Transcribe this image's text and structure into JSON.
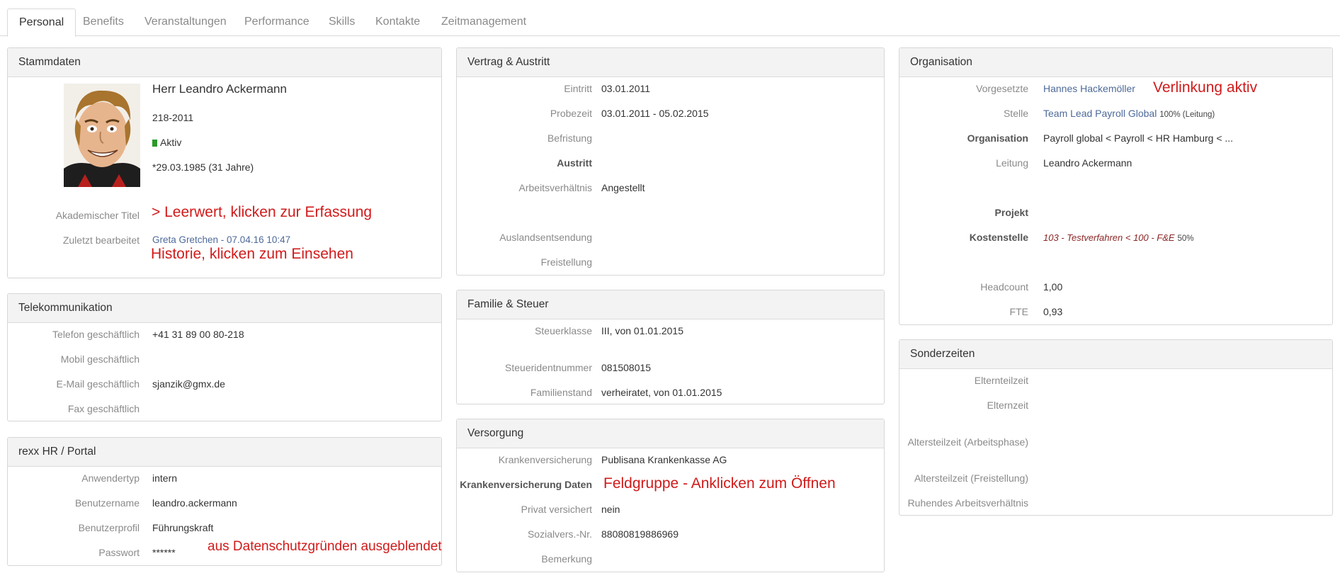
{
  "tabs": [
    "Personal",
    "Benefits",
    "Veranstaltungen",
    "Performance",
    "Skills",
    "Kontakte",
    "Zeitmanagement"
  ],
  "colors": {
    "link": "#4e6a9a",
    "annotation": "#d11a1a",
    "status_active": "#2a9a2a",
    "cost_center": "#8b2626"
  },
  "stammdaten": {
    "title": "Stammdaten",
    "name": "Herr Leandro Ackermann",
    "personnel_number": "218-2011",
    "status": "Aktiv",
    "birth": "*29.03.1985 (31 Jahre)",
    "akademischer_titel_label": "Akademischer Titel",
    "zuletzt_bearbeitet_label": "Zuletzt bearbeitet",
    "zuletzt_bearbeitet_value": "Greta Gretchen - 07.04.16 10:47"
  },
  "telekommunikation": {
    "title": "Telekommunikation",
    "rows": [
      {
        "label": "Telefon geschäftlich",
        "value": "+41 31 89 00 80-218"
      },
      {
        "label": "Mobil geschäftlich",
        "value": ""
      },
      {
        "label": "E-Mail geschäftlich",
        "value": "sjanzik@gmx.de"
      },
      {
        "label": "Fax geschäftlich",
        "value": ""
      }
    ]
  },
  "portal": {
    "title": "rexx HR / Portal",
    "rows": [
      {
        "label": "Anwendertyp",
        "value": "intern"
      },
      {
        "label": "Benutzername",
        "value": "leandro.ackermann"
      },
      {
        "label": "Benutzerprofil",
        "value": "Führungskraft"
      },
      {
        "label": "Passwort",
        "value": "******"
      }
    ]
  },
  "vertrag": {
    "title": "Vertrag & Austritt",
    "rows": [
      {
        "label": "Eintritt",
        "value": "03.01.2011"
      },
      {
        "label": "Probezeit",
        "value": "03.01.2011 - 05.02.2015"
      },
      {
        "label": "Befristung",
        "value": ""
      },
      {
        "label": "Austritt",
        "value": ""
      },
      {
        "label": "Arbeitsverhältnis",
        "value": "Angestellt"
      },
      {
        "label": "Auslandsentsendung",
        "value": ""
      },
      {
        "label": "Freistellung",
        "value": ""
      }
    ]
  },
  "familie": {
    "title": "Familie & Steuer",
    "rows": [
      {
        "label": "Steuerklasse",
        "value": "III, von 01.01.2015"
      },
      {
        "label": "Steueridentnummer",
        "value": "081508015"
      },
      {
        "label": "Familienstand",
        "value": "verheiratet, von 01.01.2015"
      }
    ]
  },
  "versorgung": {
    "title": "Versorgung",
    "rows": [
      {
        "label": "Krankenversicherung",
        "value": "Publisana Krankenkasse AG"
      },
      {
        "label": "Krankenversicherung Daten",
        "value": ""
      },
      {
        "label": "Privat versichert",
        "value": "nein"
      },
      {
        "label": "Sozialvers.-Nr.",
        "value": "88080819886969"
      },
      {
        "label": "Bemerkung",
        "value": ""
      }
    ]
  },
  "organisation": {
    "title": "Organisation",
    "vorgesetzte_label": "Vorgesetzte",
    "vorgesetzte_value": "Hannes Hackemöller",
    "stelle_label": "Stelle",
    "stelle_value": "Team Lead Payroll Global",
    "stelle_extra": "100% (Leitung)",
    "organisation_label": "Organisation",
    "organisation_value": "Payroll global < Payroll < HR Hamburg < ...",
    "leitung_label": "Leitung",
    "leitung_value": "Leandro Ackermann",
    "projekt_label": "Projekt",
    "kostenstelle_label": "Kostenstelle",
    "kostenstelle_value": "103 - Testverfahren < 100 - F&E",
    "kostenstelle_extra": "50%",
    "headcount_label": "Headcount",
    "headcount_value": "1,00",
    "fte_label": "FTE",
    "fte_value": "0,93"
  },
  "sonderzeiten": {
    "title": "Sonderzeiten",
    "rows": [
      {
        "label": "Elternteilzeit"
      },
      {
        "label": "Elternzeit"
      },
      {
        "label": "Altersteilzeit (Arbeitsphase)"
      },
      {
        "label": "Altersteilzeit (Freistellung)"
      },
      {
        "label": "Ruhendes Arbeitsverhältnis"
      }
    ]
  },
  "annotations": {
    "leerwert": "> Leerwert, klicken zur Erfassung",
    "historie": "Historie, klicken zum Einsehen",
    "datenschutz": "aus Datenschutzgründen ausgeblendet",
    "feldgruppe": "Feldgruppe - Anklicken zum Öffnen",
    "verlinkung": "Verlinkung aktiv"
  }
}
